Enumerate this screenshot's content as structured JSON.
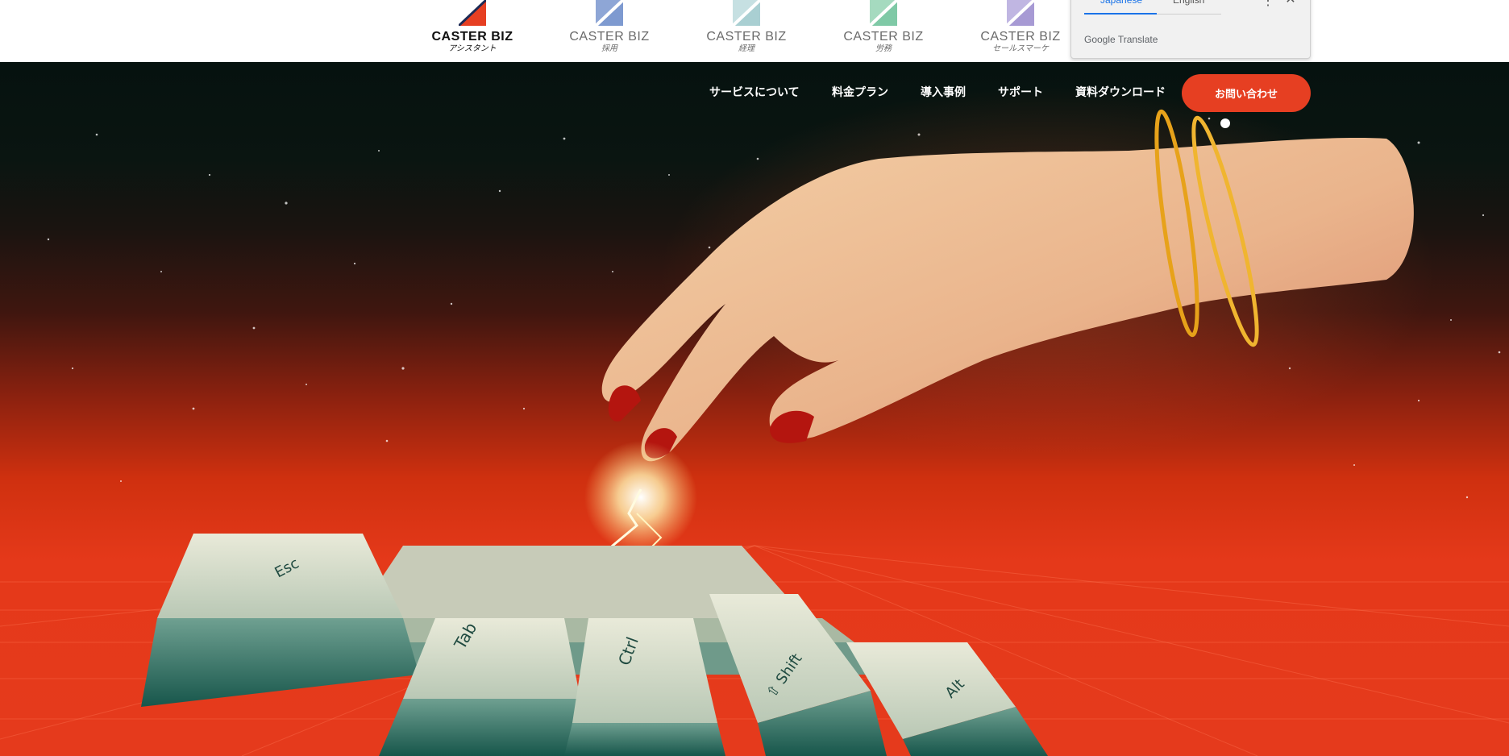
{
  "brands": [
    {
      "name": "CASTER BIZ",
      "sub": "アシスタント",
      "color": "#e63f22",
      "text_color": "#111111"
    },
    {
      "name": "CASTER BIZ",
      "sub": "採用",
      "color": "#7e9ad0",
      "text_color": "#6b6b6b"
    },
    {
      "name": "CASTER BIZ",
      "sub": "経理",
      "color": "#a9cfd2",
      "text_color": "#6b6b6b"
    },
    {
      "name": "CASTER BIZ",
      "sub": "労務",
      "color": "#7fc9a6",
      "text_color": "#6b6b6b"
    },
    {
      "name": "CASTER BIZ",
      "sub": "セールスマーケ",
      "color": "#a79ad4",
      "text_color": "#6b6b6b"
    }
  ],
  "nav": {
    "items": [
      "サービスについて",
      "料金プラン",
      "導入事例",
      "サポート",
      "資料ダウンロード"
    ],
    "cta": "お問い合わせ"
  },
  "translate": {
    "lang_active": "Japanese",
    "lang_other": "English",
    "brand_google": "Google",
    "brand_translate": "Translate"
  },
  "keys": [
    "Esc",
    "Tab",
    "Ctrl",
    "⇧ Shift",
    "Alt"
  ],
  "colors": {
    "accent": "#e63f22",
    "key_face": "#d6dccd",
    "key_side": "#1f6b5e"
  }
}
